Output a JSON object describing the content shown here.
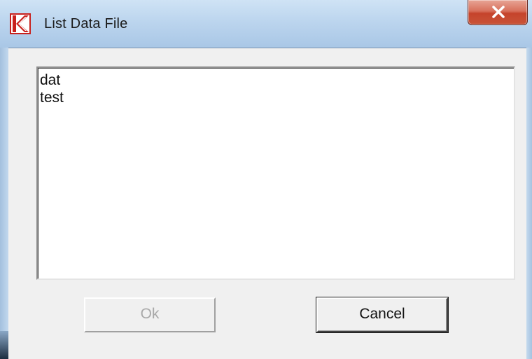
{
  "window": {
    "title": "List Data File",
    "app_icon": "k-logo-icon",
    "close_icon": "close-icon"
  },
  "listbox": {
    "items": [
      "dat",
      "test"
    ]
  },
  "buttons": {
    "ok_label": "Ok",
    "ok_enabled": false,
    "cancel_label": "Cancel"
  },
  "colors": {
    "title_bar": "#bcd5ee",
    "close_button": "#c5432b",
    "dialog_bg": "#f0f0f0",
    "disabled_text": "#a8a8a8"
  }
}
